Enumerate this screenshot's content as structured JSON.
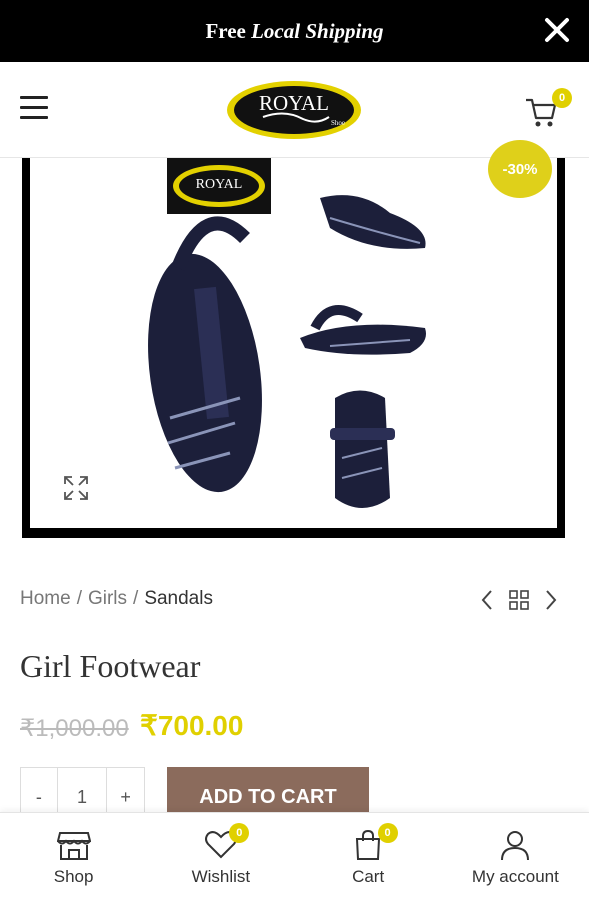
{
  "promo": {
    "bold": "Free",
    "italic": "Local Shipping"
  },
  "header": {
    "logo_text": "ROYAL",
    "logo_sub": "Shoe",
    "cart_count": "0"
  },
  "product": {
    "sale_badge": "-30%",
    "breadcrumb": [
      "Home",
      "Girls",
      "Sandals"
    ],
    "title": "Girl Footwear",
    "price_old": "₹1,000.00",
    "price_new": "₹700.00",
    "quantity": "1",
    "qty_minus": "-",
    "qty_plus": "+",
    "add_to_cart": "ADD TO CART"
  },
  "tabbar": {
    "shop": "Shop",
    "wishlist": "Wishlist",
    "wishlist_count": "0",
    "cart": "Cart",
    "cart_count": "0",
    "account": "My account"
  },
  "colors": {
    "accent": "#e0d000",
    "button": "#8b6b5c",
    "topbar": "#000000"
  }
}
